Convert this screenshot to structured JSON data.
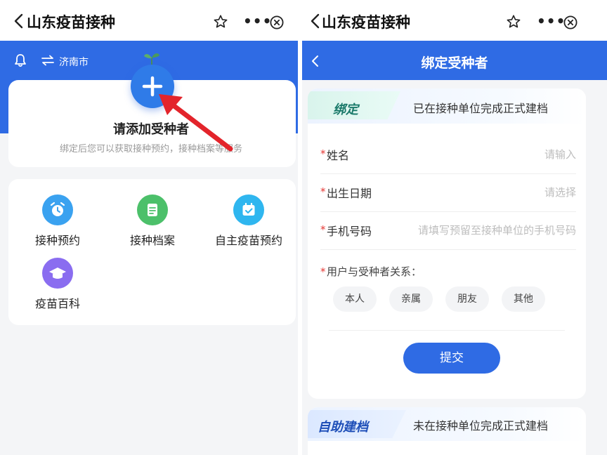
{
  "left": {
    "topbar": {
      "title": "山东疫苗接种"
    },
    "header": {
      "city": "济南市"
    },
    "add_card": {
      "title": "请添加受种者",
      "subtitle": "绑定后您可以获取接种预约，接种档案等服务"
    },
    "services": [
      {
        "label": "接种预约",
        "icon": "alarm-clock-icon",
        "color": "#3aa2f0"
      },
      {
        "label": "接种档案",
        "icon": "document-icon",
        "color": "#4cc06a"
      },
      {
        "label": "自主疫苗预约",
        "icon": "calendar-check-icon",
        "color": "#2fb6ef"
      },
      {
        "label": "疫苗百科",
        "icon": "graduation-cap-icon",
        "color": "#8a6df0"
      }
    ]
  },
  "right": {
    "topbar": {
      "title": "山东疫苗接种"
    },
    "header": {
      "title": "绑定受种者"
    },
    "bind_card": {
      "tag": "绑定",
      "description": "已在接种单位完成正式建档",
      "fields": [
        {
          "label": "姓名",
          "placeholder": "请输入"
        },
        {
          "label": "出生日期",
          "placeholder": "请选择"
        },
        {
          "label": "手机号码",
          "placeholder": "请填写预留至接种单位的手机号码"
        }
      ],
      "relation_label": "用户与受种者关系：",
      "relations": [
        "本人",
        "亲属",
        "朋友",
        "其他"
      ],
      "submit_label": "提交"
    },
    "self_card": {
      "tag": "自助建档",
      "description": "未在接种单位完成正式建档"
    }
  },
  "colors": {
    "primary": "#2f6be4",
    "required": "#e53935",
    "arrow": "#e3242b"
  }
}
